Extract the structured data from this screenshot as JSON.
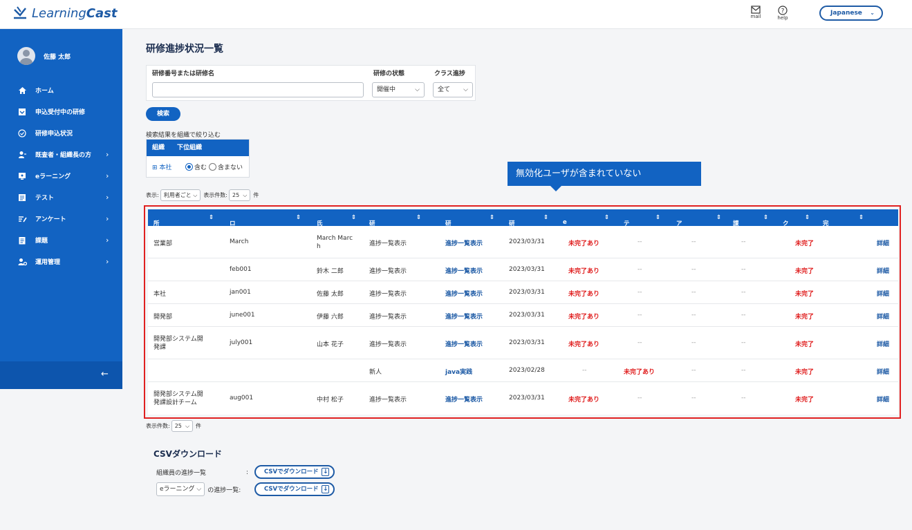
{
  "header": {
    "logo_text_a": "Learning",
    "logo_text_b": "Cast",
    "mail_label": "mail",
    "help_label": "help",
    "language": "Japanese"
  },
  "sidebar": {
    "user_name": "佐藤 太郎",
    "items": [
      {
        "label": "ホーム",
        "icon": "home-icon"
      },
      {
        "label": "申込受付中の研修",
        "icon": "inbox-icon"
      },
      {
        "label": "研修申込状況",
        "icon": "check-circle-icon"
      },
      {
        "label": "既査者・組織長の方",
        "icon": "users-icon"
      },
      {
        "label": "eラーニング",
        "icon": "monitor-icon"
      },
      {
        "label": "テスト",
        "icon": "test-icon"
      },
      {
        "label": "アンケート",
        "icon": "survey-icon"
      },
      {
        "label": "課題",
        "icon": "assignment-icon"
      },
      {
        "label": "運用管理",
        "icon": "admin-icon"
      }
    ],
    "collapse_arrow": "←"
  },
  "page": {
    "title": "研修進捗状況一覧",
    "filter": {
      "code_label": "研修番号または研修名",
      "code_value": "",
      "status_label": "研修の状態",
      "status_value": "開催中",
      "class_label": "クラス進捗",
      "class_value": "全て"
    },
    "search_button": "検索",
    "org_filter": {
      "label": "検索結果を組織で絞り込む",
      "col_org": "組織",
      "col_sub": "下位組織",
      "tree_toggle": "⊞",
      "org_name": "本社",
      "include": "含む",
      "exclude": "含まない"
    },
    "tooltip": "無効化ユーザが含まれていない",
    "display": {
      "label": "表示:",
      "mode": "利用者ごと",
      "count_label": "表示件数:",
      "count": "25",
      "unit": "件"
    }
  },
  "table": {
    "columns": [
      "所属組織",
      "ログインID",
      "氏名",
      "研修番号",
      "研修名",
      "研修終了日",
      "eラーニング",
      "テスト",
      "アンケート",
      "課題",
      "クラス",
      "完了日時"
    ],
    "sort_glyph": "⇕",
    "rows": [
      {
        "org": "営業部",
        "login": "March",
        "name": "March Marc h",
        "code": "進捗一覧表示",
        "course": "進捗一覧表示",
        "end": "2023/03/31",
        "el": "未完了あり",
        "test": "--",
        "survey": "--",
        "task": "--",
        "class": "未完了",
        "done": "",
        "detail": "詳細"
      },
      {
        "org": "",
        "login": "feb001",
        "name": "鈴木 二郎",
        "code": "進捗一覧表示",
        "course": "進捗一覧表示",
        "end": "2023/03/31",
        "el": "未完了あり",
        "test": "--",
        "survey": "--",
        "task": "--",
        "class": "未完了",
        "done": "",
        "detail": "詳細"
      },
      {
        "org": "本社",
        "login": "jan001",
        "name": "佐藤 太郎",
        "code": "進捗一覧表示",
        "course": "進捗一覧表示",
        "end": "2023/03/31",
        "el": "未完了あり",
        "test": "--",
        "survey": "--",
        "task": "--",
        "class": "未完了",
        "done": "",
        "detail": "詳細"
      },
      {
        "org": "開発部",
        "login": "june001",
        "name": "伊藤 六郎",
        "code": "進捗一覧表示",
        "course": "進捗一覧表示",
        "end": "2023/03/31",
        "el": "未完了あり",
        "test": "--",
        "survey": "--",
        "task": "--",
        "class": "未完了",
        "done": "",
        "detail": "詳細"
      },
      {
        "org": "開発部システム開発課",
        "login": "july001",
        "name": "山本 花子",
        "code": "進捗一覧表示",
        "course": "進捗一覧表示",
        "end": "2023/03/31",
        "el": "未完了あり",
        "test": "--",
        "survey": "--",
        "task": "--",
        "class": "未完了",
        "done": "",
        "detail": "詳細"
      },
      {
        "org": "",
        "login": "",
        "name": "",
        "code": "新人",
        "course": "java実践",
        "end": "2023/02/28",
        "el": "--",
        "test": "未完了あり",
        "survey": "--",
        "task": "--",
        "class": "未完了",
        "done": "",
        "detail": "詳細"
      },
      {
        "org": "開発部システム開発課設計チーム",
        "login": "aug001",
        "name": "中村 松子",
        "code": "進捗一覧表示",
        "course": "進捗一覧表示",
        "end": "2023/03/31",
        "el": "未完了あり",
        "test": "--",
        "survey": "--",
        "task": "--",
        "class": "未完了",
        "done": "",
        "detail": "詳細"
      }
    ]
  },
  "bottom_display": {
    "count_label": "表示件数:",
    "count": "25",
    "unit": "件"
  },
  "csv": {
    "title": "CSVダウンロード",
    "row1_label": "組織員の進捗一覧",
    "colon": ":",
    "row2_select": "eラーニング",
    "row2_suffix": "の進捗一覧:",
    "button_label": "CSVでダウンロード"
  },
  "colors": {
    "primary": "#1263c2",
    "highlight_border": "#e02020",
    "status_red": "#e02020"
  }
}
